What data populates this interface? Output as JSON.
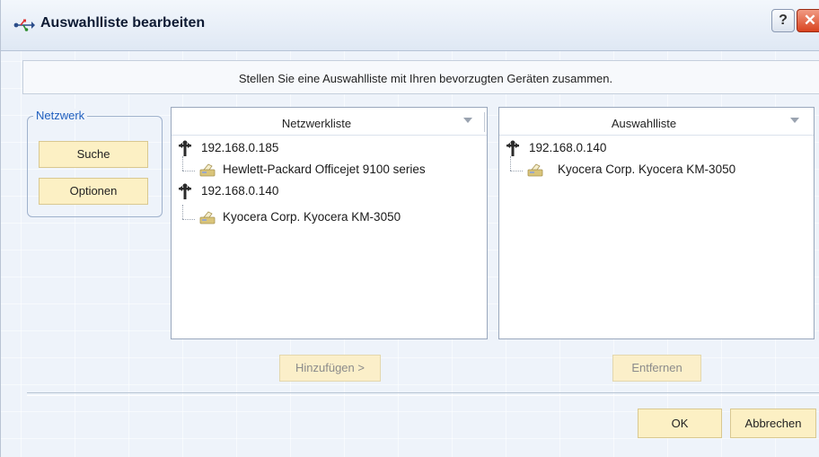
{
  "dialog": {
    "title": "Auswahlliste bearbeiten",
    "help_label": "?",
    "close_label": "✕",
    "info_text": "Stellen Sie eine Auswahlliste mit Ihren bevorzugten Geräten zusammen."
  },
  "network_group": {
    "label": "Netzwerk",
    "search_button": "Suche",
    "options_button": "Optionen"
  },
  "network_list": {
    "header": "Netzwerkliste",
    "items": [
      {
        "host": "192.168.0.185",
        "device": "Hewlett-Packard Officejet 9100 series"
      },
      {
        "host": "192.168.0.140",
        "device": "Kyocera Corp. Kyocera KM-3050"
      }
    ]
  },
  "selection_list": {
    "header": "Auswahlliste",
    "items": [
      {
        "host": "192.168.0.140",
        "device": "Kyocera Corp. Kyocera KM-3050"
      }
    ]
  },
  "actions": {
    "add_button": "Hinzufügen >",
    "remove_button": "Entfernen",
    "ok_button": "OK",
    "cancel_button": "Abbrechen"
  },
  "icons": {
    "title": "usb-connection-icon",
    "host": "network-node-icon",
    "device": "printer-icon"
  },
  "colors": {
    "button_fill": "#fcf0c4",
    "group_label": "#1f5fbf",
    "close_red": "#d9431f"
  }
}
